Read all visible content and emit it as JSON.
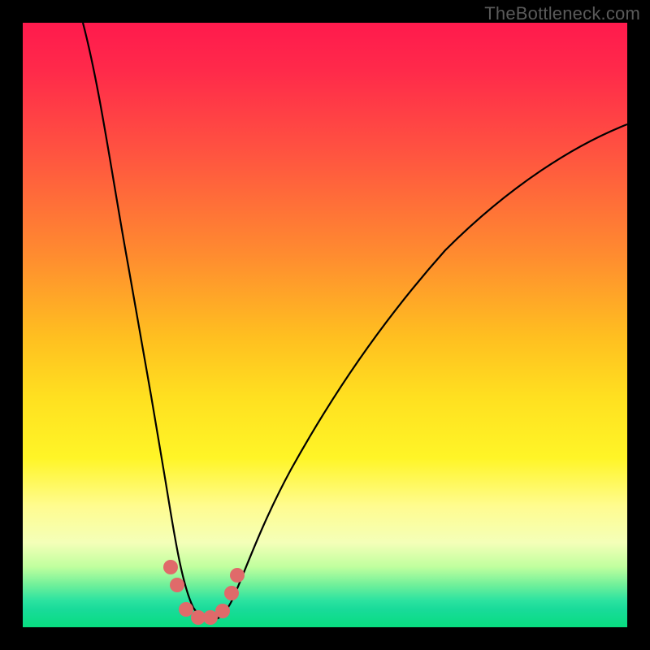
{
  "watermark": "TheBottleneck.com",
  "colors": {
    "frame": "#000000",
    "curve_stroke": "#000000",
    "marker_fill": "#e06a6a",
    "gradient_top": "#ff1a4d",
    "gradient_bottom": "#08dd80"
  },
  "chart_data": {
    "type": "line",
    "title": "",
    "xlabel": "",
    "ylabel": "",
    "xlim": [
      0,
      100
    ],
    "ylim": [
      0,
      100
    ],
    "notes": "Background vertical gradient from red (y≈100) through orange/yellow to green (y≈0). V-shaped curve with minimum near x≈30, y≈2. Both branches rise toward top; left branch reaches y=100 near x≈10, right branch reaches y≈77 at x=100. Salmon circular markers cluster near the trough.",
    "series": [
      {
        "name": "bottleneck-curve",
        "x": [
          10,
          14,
          18,
          22,
          24,
          26,
          28,
          30,
          32,
          34,
          36,
          40,
          45,
          50,
          55,
          60,
          65,
          70,
          75,
          80,
          85,
          90,
          95,
          100
        ],
        "y": [
          100,
          78,
          56,
          32,
          20,
          10,
          4,
          2,
          3,
          6,
          10,
          18,
          27,
          34,
          41,
          47,
          52,
          57,
          62,
          66,
          70,
          73,
          75,
          77
        ]
      },
      {
        "name": "markers",
        "x": [
          24.5,
          25.5,
          27,
          29,
          31,
          33,
          34.5,
          35.5
        ],
        "y": [
          10,
          7,
          3,
          2,
          2,
          3.5,
          6,
          9
        ]
      }
    ]
  }
}
